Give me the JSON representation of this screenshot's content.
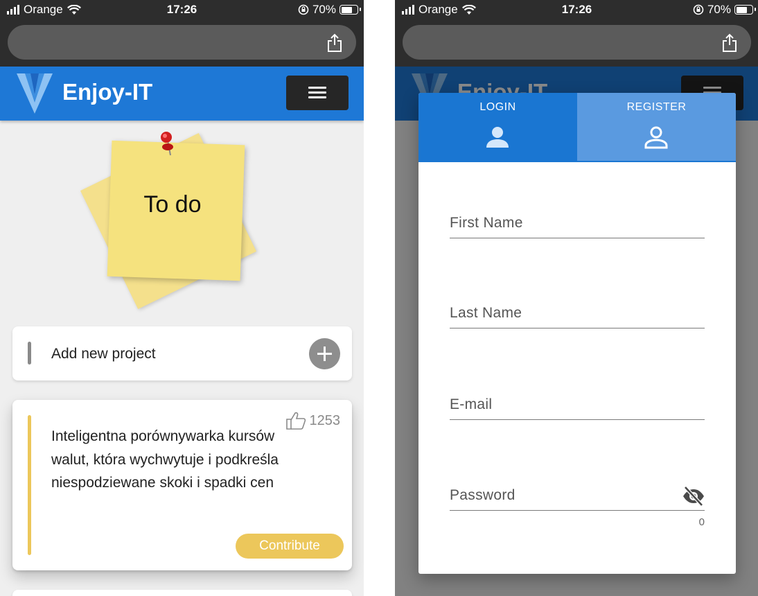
{
  "status_bar": {
    "carrier": "Orange",
    "time": "17:26",
    "battery": "70%",
    "battery_level": 0.7
  },
  "app": {
    "brand": "Enjoy-IT",
    "colors": {
      "primary": "#1e78d6",
      "accent": "#ecc75b",
      "dark": "#262626"
    }
  },
  "todo_view": {
    "sticky_note": "To do",
    "add_project_label": "Add new project",
    "projects": [
      {
        "likes": "1253",
        "description": "Inteligentna porównywarka kursów walut, która wychwytuje i podkreśla niespodziewane skoki i spadki cen",
        "action": "Contribute"
      }
    ]
  },
  "register_dialog": {
    "tabs": [
      {
        "label": "LOGIN",
        "icon": "person-filled-icon"
      },
      {
        "label": "REGISTER",
        "icon": "person-outline-icon",
        "active": true
      }
    ],
    "fields": [
      {
        "label": "First Name"
      },
      {
        "label": "Last Name"
      },
      {
        "label": "E-mail"
      },
      {
        "label": "Password",
        "icon": "eye-off-icon"
      }
    ],
    "password_counter": "0"
  }
}
